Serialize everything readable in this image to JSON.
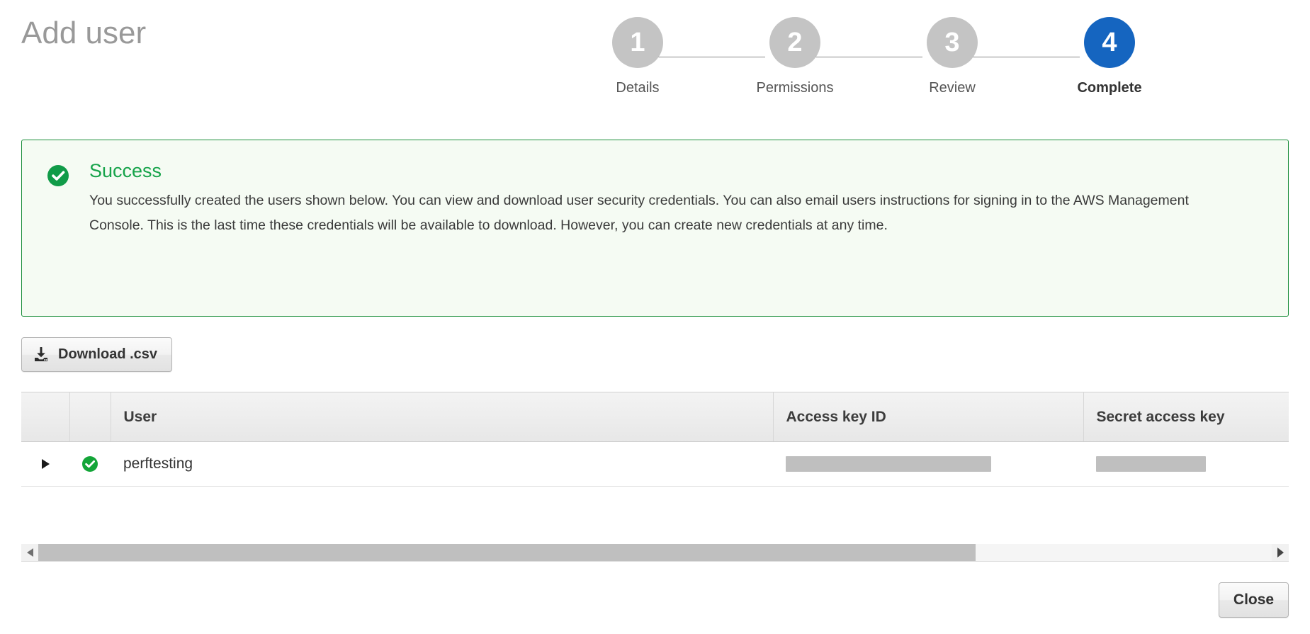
{
  "page": {
    "title": "Add user"
  },
  "stepper": {
    "steps": [
      {
        "number": "1",
        "label": "Details",
        "state": "inactive"
      },
      {
        "number": "2",
        "label": "Permissions",
        "state": "inactive"
      },
      {
        "number": "3",
        "label": "Review",
        "state": "inactive"
      },
      {
        "number": "4",
        "label": "Complete",
        "state": "active"
      }
    ],
    "active_color": "#1565c0",
    "inactive_color": "#c4c4c4"
  },
  "alert": {
    "icon": "check-circle-icon",
    "title": "Success",
    "title_color": "#16a34a",
    "border_color": "#1c8f3c",
    "background_color": "#f5fbf3",
    "message": "You successfully created the users shown below. You can view and download user security credentials. You can also email users instructions for signing in to the AWS Management Console. This is the last time these credentials will be available to download. However, you can create new credentials at any time."
  },
  "toolbar": {
    "download_label": "Download .csv",
    "download_icon": "download-icon"
  },
  "table": {
    "columns": [
      "",
      "",
      "User",
      "Access key ID",
      "Secret access key"
    ],
    "rows": [
      {
        "expand_icon": "triangle-right-icon",
        "status_icon": "check-circle-icon",
        "user": "perftesting",
        "access_key_id": "",
        "secret_access_key": "",
        "access_key_id_redacted": true,
        "secret_access_key_redacted": true
      }
    ]
  },
  "scrollbar": {
    "left_arrow_icon": "arrow-left-icon",
    "right_arrow_icon": "arrow-right-icon",
    "thumb_fraction": "76%"
  },
  "footer": {
    "close_label": "Close"
  }
}
